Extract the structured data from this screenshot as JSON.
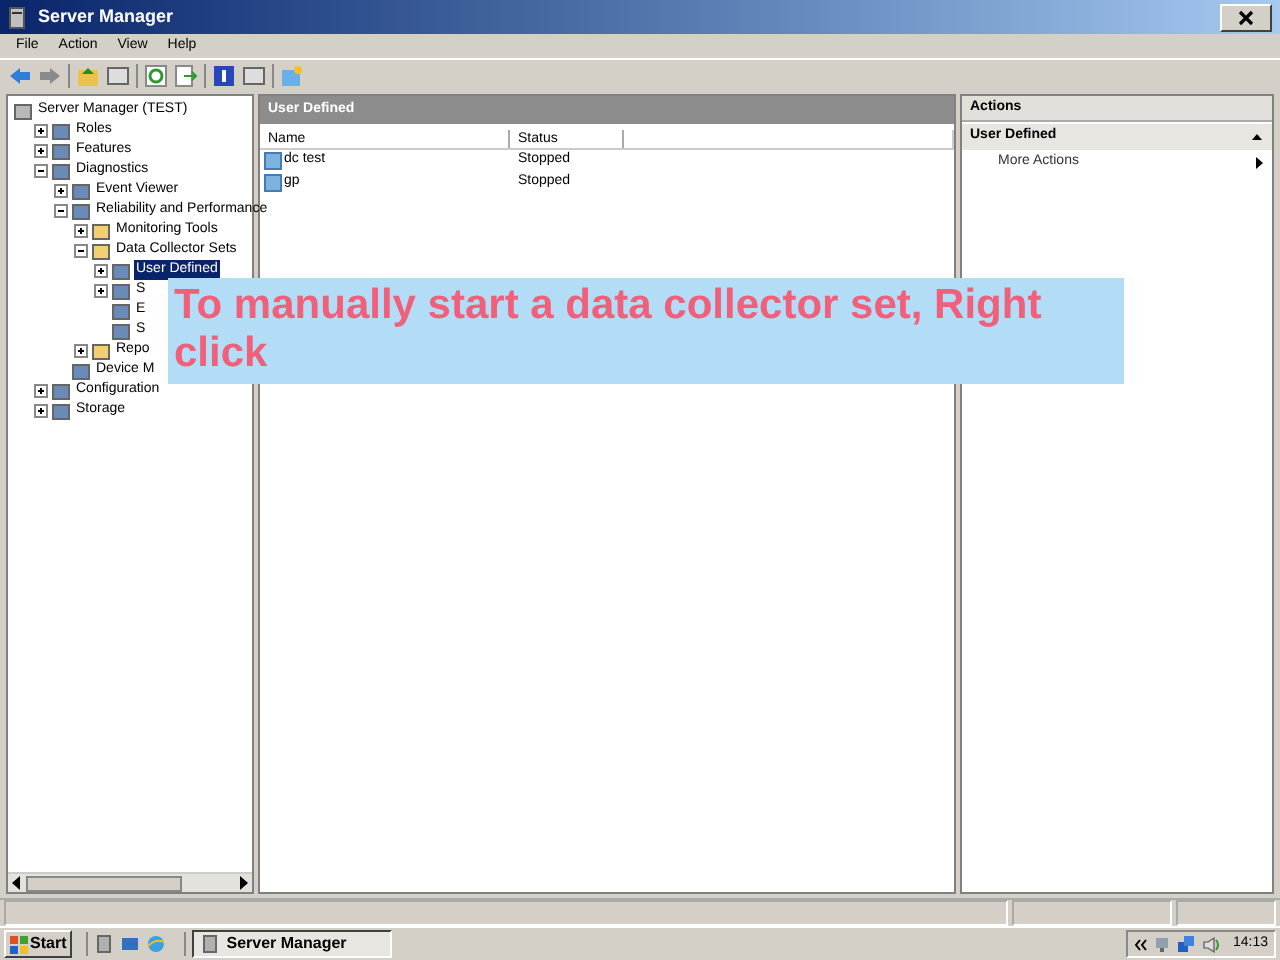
{
  "window": {
    "title": "Server Manager"
  },
  "menu": [
    "File",
    "Action",
    "View",
    "Help"
  ],
  "tree": [
    {
      "label": "Server Manager (TEST)",
      "selected": false,
      "children": [
        {
          "label": "Roles",
          "selected": false,
          "expanded": false
        },
        {
          "label": "Features",
          "selected": false,
          "expanded": false
        },
        {
          "label": "Diagnostics",
          "selected": false,
          "expanded": true,
          "children": [
            {
              "label": "Event Viewer",
              "selected": false,
              "expanded": false
            },
            {
              "label": "Reliability and Performance",
              "selected": false,
              "expanded": true,
              "children": [
                {
                  "label": "Monitoring Tools",
                  "selected": false,
                  "expanded": false
                },
                {
                  "label": "Data Collector Sets",
                  "selected": false,
                  "expanded": true,
                  "children": [
                    {
                      "label": "User Defined",
                      "selected": true,
                      "expanded": false
                    },
                    {
                      "label": "S",
                      "selected": false,
                      "expanded": false
                    },
                    {
                      "label": "E",
                      "selected": false
                    },
                    {
                      "label": "S",
                      "selected": false
                    }
                  ]
                },
                {
                  "label": "Repo",
                  "selected": false,
                  "expanded": false
                }
              ]
            },
            {
              "label": "Device M",
              "selected": false
            }
          ]
        },
        {
          "label": "Configuration",
          "selected": false,
          "expanded": false
        },
        {
          "label": "Storage",
          "selected": false,
          "expanded": false
        }
      ]
    }
  ],
  "content": {
    "title": "User Defined",
    "columns": [
      "Name",
      "Status"
    ],
    "rows": [
      {
        "name": "dc test",
        "status": "Stopped"
      },
      {
        "name": "gp",
        "status": "Stopped"
      }
    ]
  },
  "actions": {
    "title": "Actions",
    "section": "User Defined",
    "items": [
      "More Actions"
    ]
  },
  "overlay": {
    "text": "To manually start a data collector set, Right click"
  },
  "taskbar": {
    "start": "Start",
    "task": "Server Manager",
    "time": "14:13"
  }
}
